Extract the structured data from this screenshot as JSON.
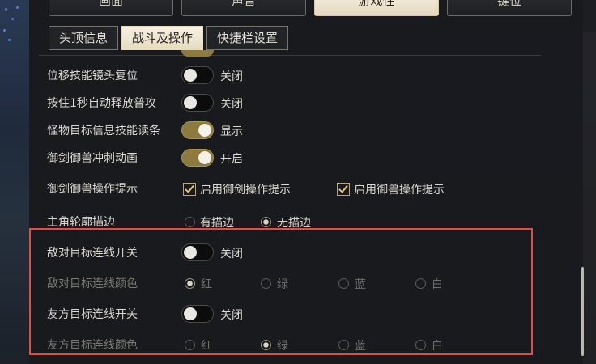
{
  "main_tabs": [
    "画面",
    "声音",
    "游戏性",
    "键位"
  ],
  "sub_tabs": [
    "头顶信息",
    "战斗及操作",
    "快捷栏设置"
  ],
  "settings": {
    "row1": {
      "label": "位移技能镜头复位",
      "state": "关闭"
    },
    "row2": {
      "label": "按住1秒自动释放普攻",
      "state": "关闭"
    },
    "row3": {
      "label": "怪物目标信息技能读条",
      "state": "显示"
    },
    "row4": {
      "label": "御剑御兽冲刺动画",
      "state": "开启"
    },
    "row5": {
      "label": "御剑御兽操作提示",
      "opt1": "启用御剑操作提示",
      "opt2": "启用御兽操作提示"
    },
    "row6": {
      "label": "主角轮廓描边",
      "opt1": "有描边",
      "opt2": "无描边"
    },
    "row7": {
      "label": "敌对目标连线开关",
      "state": "关闭"
    },
    "row8": {
      "label": "敌对目标连线颜色",
      "colors": [
        "红",
        "绿",
        "蓝",
        "白"
      ]
    },
    "row9": {
      "label": "友方目标连线开关",
      "state": "关闭"
    },
    "row10": {
      "label": "友方目标连线颜色",
      "colors": [
        "红",
        "绿",
        "蓝",
        "白"
      ]
    }
  }
}
